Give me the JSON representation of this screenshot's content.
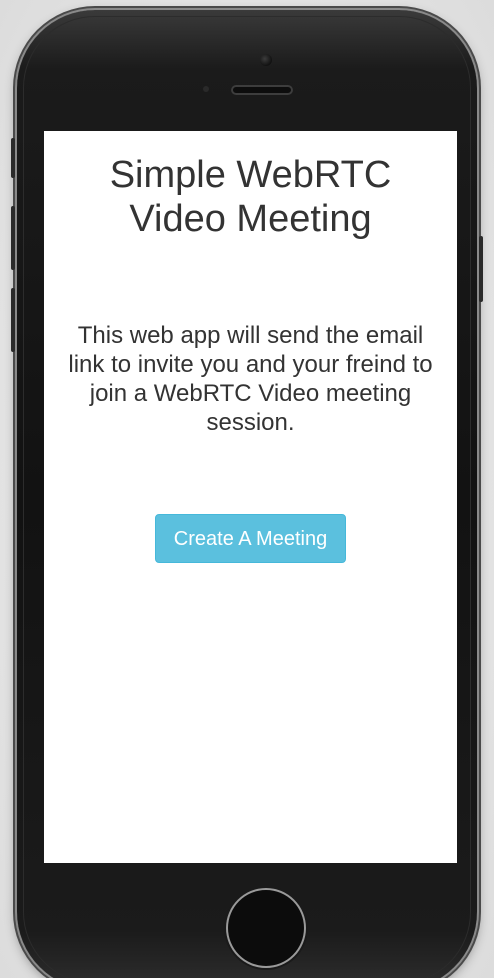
{
  "page": {
    "title": "Simple WebRTC Video Meeting",
    "description": "This web app will send the email link to invite you and your freind to join a WebRTC Video meeting session.",
    "create_button_label": "Create A Meeting"
  },
  "device": {
    "frame": "smartphone",
    "icons": [
      "front-camera-icon",
      "earpiece-speaker-icon",
      "proximity-sensor-icon",
      "home-button-icon"
    ]
  },
  "colors": {
    "button_background": "#5bc0de",
    "button_text": "#ffffff",
    "text": "#333333",
    "screen_background": "#ffffff",
    "device_body": "#121212"
  }
}
